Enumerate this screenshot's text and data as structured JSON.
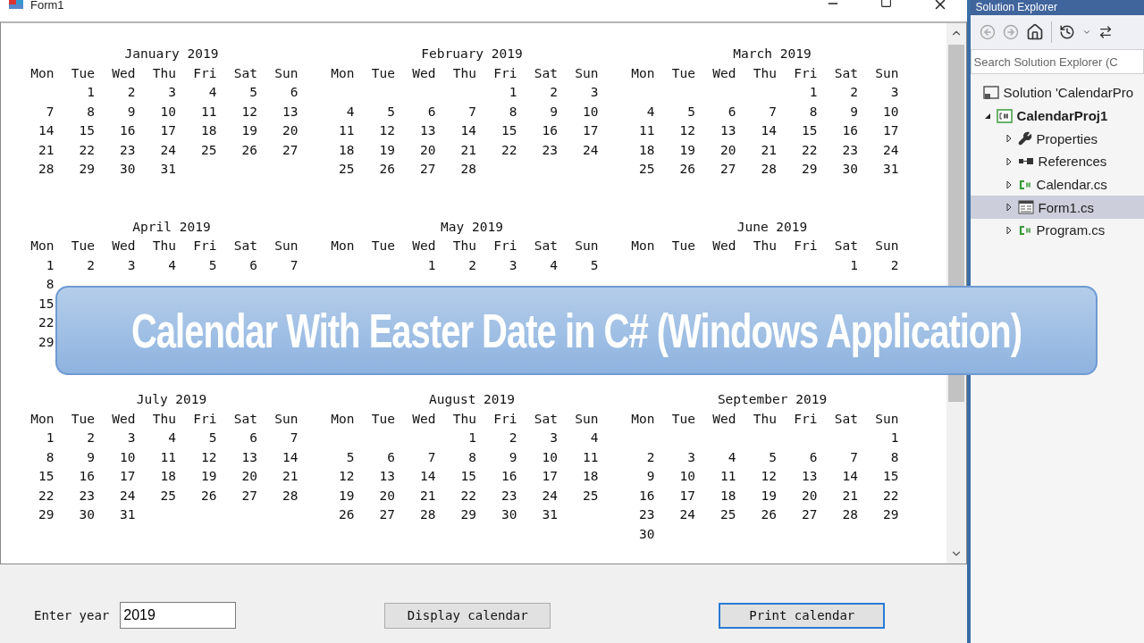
{
  "window": {
    "title": "Form1"
  },
  "calendar": {
    "months": [
      {
        "title": "January 2019",
        "weekdays": [
          "Mon",
          "Tue",
          "Wed",
          "Thu",
          "Fri",
          "Sat",
          "Sun"
        ],
        "weeks": [
          {
            "days": [
              "1",
              "2",
              "3",
              "4",
              "5",
              "6"
            ],
            "starts_midweek": true
          },
          {
            "days": [
              "7",
              "8",
              "9",
              "10",
              "11",
              "12",
              "13"
            ]
          },
          {
            "days": [
              "14",
              "15",
              "16",
              "17",
              "18",
              "19",
              "20"
            ]
          },
          {
            "days": [
              "21",
              "22",
              "23",
              "24",
              "25",
              "26",
              "27"
            ]
          },
          {
            "days": [
              "28",
              "29",
              "30",
              "31"
            ]
          }
        ]
      },
      {
        "title": "February 2019",
        "weekdays": [
          "Mon",
          "Tue",
          "Wed",
          "Thu",
          "Fri",
          "Sat",
          "Sun"
        ],
        "weeks": [
          {
            "days": [
              "1",
              "2",
              "3"
            ],
            "starts_midweek": true
          },
          {
            "days": [
              "4",
              "5",
              "6",
              "7",
              "8",
              "9",
              "10"
            ]
          },
          {
            "days": [
              "11",
              "12",
              "13",
              "14",
              "15",
              "16",
              "17"
            ]
          },
          {
            "days": [
              "18",
              "19",
              "20",
              "21",
              "22",
              "23",
              "24"
            ]
          },
          {
            "days": [
              "25",
              "26",
              "27",
              "28"
            ]
          }
        ]
      },
      {
        "title": "March 2019",
        "weekdays": [
          "Mon",
          "Tue",
          "Wed",
          "Thu",
          "Fri",
          "Sat",
          "Sun"
        ],
        "weeks": [
          {
            "days": [
              "1",
              "2",
              "3"
            ],
            "starts_midweek": true
          },
          {
            "days": [
              "4",
              "5",
              "6",
              "7",
              "8",
              "9",
              "10"
            ]
          },
          {
            "days": [
              "11",
              "12",
              "13",
              "14",
              "15",
              "16",
              "17"
            ]
          },
          {
            "days": [
              "18",
              "19",
              "20",
              "21",
              "22",
              "23",
              "24"
            ]
          },
          {
            "days": [
              "25",
              "26",
              "27",
              "28",
              "29",
              "30",
              "31"
            ]
          }
        ]
      },
      {
        "title": "April 2019",
        "weekdays": [
          "Mon",
          "Tue",
          "Wed",
          "Thu",
          "Fri",
          "Sat",
          "Sun"
        ],
        "weeks": [
          {
            "days": [
              "1",
              "2",
              "3",
              "4",
              "5",
              "6",
              "7"
            ]
          },
          {
            "days": [
              "8"
            ]
          },
          {
            "days": [
              "15"
            ]
          },
          {
            "days": [
              "22"
            ]
          },
          {
            "days": [
              "29"
            ]
          }
        ]
      },
      {
        "title": "May 2019",
        "weekdays": [
          "Mon",
          "Tue",
          "Wed",
          "Thu",
          "Fri",
          "Sat",
          "Sun"
        ],
        "weeks": [
          {
            "days": [
              "1",
              "2",
              "3",
              "4",
              "5"
            ],
            "starts_midweek": true
          }
        ]
      },
      {
        "title": "June 2019",
        "weekdays": [
          "Mon",
          "Tue",
          "Wed",
          "Thu",
          "Fri",
          "Sat",
          "Sun"
        ],
        "weeks": [
          {
            "days": [
              "1",
              "2"
            ],
            "starts_midweek": true
          }
        ]
      },
      {
        "title": "July 2019",
        "weekdays": [
          "Mon",
          "Tue",
          "Wed",
          "Thu",
          "Fri",
          "Sat",
          "Sun"
        ],
        "weeks": [
          {
            "days": [
              "1",
              "2",
              "3",
              "4",
              "5",
              "6",
              "7"
            ]
          },
          {
            "days": [
              "8",
              "9",
              "10",
              "11",
              "12",
              "13",
              "14"
            ]
          },
          {
            "days": [
              "15",
              "16",
              "17",
              "18",
              "19",
              "20",
              "21"
            ]
          },
          {
            "days": [
              "22",
              "23",
              "24",
              "25",
              "26",
              "27",
              "28"
            ]
          },
          {
            "days": [
              "29",
              "30",
              "31"
            ]
          }
        ]
      },
      {
        "title": "August 2019",
        "weekdays": [
          "Mon",
          "Tue",
          "Wed",
          "Thu",
          "Fri",
          "Sat",
          "Sun"
        ],
        "weeks": [
          {
            "days": [
              "1",
              "2",
              "3",
              "4"
            ],
            "starts_midweek": true
          },
          {
            "days": [
              "5",
              "6",
              "7",
              "8",
              "9",
              "10",
              "11"
            ]
          },
          {
            "days": [
              "12",
              "13",
              "14",
              "15",
              "16",
              "17",
              "18"
            ]
          },
          {
            "days": [
              "19",
              "20",
              "21",
              "22",
              "23",
              "24",
              "25"
            ]
          },
          {
            "days": [
              "26",
              "27",
              "28",
              "29",
              "30",
              "31"
            ]
          }
        ]
      },
      {
        "title": "September 2019",
        "weekdays": [
          "Mon",
          "Tue",
          "Wed",
          "Thu",
          "Fri",
          "Sat",
          "Sun"
        ],
        "weeks": [
          {
            "days": [
              "1"
            ],
            "starts_midweek": true
          },
          {
            "days": [
              "2",
              "3",
              "4",
              "5",
              "6",
              "7",
              "8"
            ]
          },
          {
            "days": [
              "9",
              "10",
              "11",
              "12",
              "13",
              "14",
              "15"
            ]
          },
          {
            "days": [
              "16",
              "17",
              "18",
              "19",
              "20",
              "21",
              "22"
            ]
          },
          {
            "days": [
              "23",
              "24",
              "25",
              "26",
              "27",
              "28",
              "29"
            ]
          },
          {
            "days": [
              "30"
            ]
          }
        ]
      }
    ]
  },
  "year_input": {
    "label": "Enter year",
    "value": "2019"
  },
  "buttons": [
    {
      "label": "Display calendar",
      "default": false
    },
    {
      "label": "Print calendar",
      "default": true
    }
  ],
  "solution_explorer": {
    "title": "Solution Explorer",
    "search": {
      "placeholder": "Search Solution Explorer (C"
    },
    "tree": [
      {
        "label": "Solution 'CalendarPro",
        "kind": "solution",
        "selected": false,
        "children": [
          {
            "label": "CalendarProj1",
            "kind": "project",
            "expanded": true,
            "selected": false,
            "children": [
              {
                "label": "Properties",
                "kind": "properties",
                "expanded": false,
                "selected": false
              },
              {
                "label": "References",
                "kind": "references",
                "expanded": false,
                "selected": false
              },
              {
                "label": "Calendar.cs",
                "kind": "code",
                "expanded": false,
                "selected": false
              },
              {
                "label": "Form1.cs",
                "kind": "form",
                "expanded": false,
                "selected": true
              },
              {
                "label": "Program.cs",
                "kind": "code",
                "expanded": false,
                "selected": false
              }
            ]
          }
        ]
      }
    ]
  },
  "banner": {
    "text": "Calendar With Easter Date in C# (Windows Application)"
  }
}
